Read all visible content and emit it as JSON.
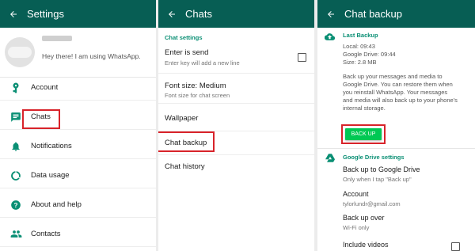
{
  "colors": {
    "appbar": "#075e54",
    "accent": "#0a8f74",
    "backup_button": "#00c853",
    "highlight": "#d8232a"
  },
  "settings_panel": {
    "title": "Settings",
    "profile": {
      "status": "Hey there! I am using WhatsApp."
    },
    "menu": [
      {
        "label": "Account",
        "icon": "key-icon"
      },
      {
        "label": "Chats",
        "icon": "chat-icon"
      },
      {
        "label": "Notifications",
        "icon": "bell-icon"
      },
      {
        "label": "Data usage",
        "icon": "data-usage-icon"
      },
      {
        "label": "About and help",
        "icon": "help-icon"
      },
      {
        "label": "Contacts",
        "icon": "contacts-icon"
      }
    ]
  },
  "chats_panel": {
    "title": "Chats",
    "section": "Chat settings",
    "enter_is_send": {
      "title": "Enter is send",
      "subtitle": "Enter key will add a new line"
    },
    "font_size": {
      "title": "Font size: Medium",
      "subtitle": "Font size for chat screen"
    },
    "wallpaper": "Wallpaper",
    "chat_backup": "Chat backup",
    "chat_history": "Chat history"
  },
  "backup_panel": {
    "title": "Chat backup",
    "last_backup": {
      "heading": "Last Backup",
      "local": "Local: 09:43",
      "google_drive": "Google Drive: 09:44",
      "size": "Size: 2.8 MB",
      "description": [
        "Back up your messages and media to",
        "Google Drive. You can restore them when",
        "you reinstall WhatsApp. Your messages",
        "and media will also back up to your phone's",
        "internal storage."
      ],
      "button": "BACK UP"
    },
    "drive": {
      "heading": "Google Drive settings",
      "backup_to_drive": {
        "title": "Back up to Google Drive",
        "subtitle": "Only when I tap \"Back up\""
      },
      "account": {
        "title": "Account",
        "subtitle": "tylorlundr@gmail.com"
      },
      "backup_over": {
        "title": "Back up over",
        "subtitle": "Wi-Fi only"
      },
      "include_videos": {
        "title": "Include videos"
      }
    }
  }
}
